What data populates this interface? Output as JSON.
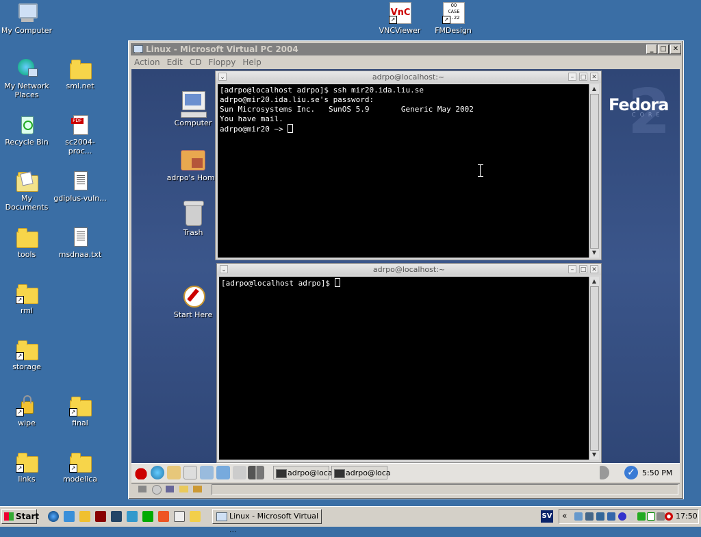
{
  "desktop": {
    "icons": [
      {
        "label": "My Computer",
        "icon": "my-computer-icon"
      },
      {
        "label": "My Network\nPlaces",
        "icon": "network-icon"
      },
      {
        "label": "sml.net",
        "icon": "folder-icon"
      },
      {
        "label": "Recycle Bin",
        "icon": "recycle-bin-icon"
      },
      {
        "label": "sc2004-proc...",
        "icon": "pdf-icon"
      },
      {
        "label": "My Documents",
        "icon": "my-documents-icon"
      },
      {
        "label": "gdiplus-vuln...",
        "icon": "text-file-icon"
      },
      {
        "label": "tools",
        "icon": "folder-icon"
      },
      {
        "label": "msdnaa.txt",
        "icon": "text-file-icon"
      },
      {
        "label": "rml",
        "icon": "folder-shortcut-icon"
      },
      {
        "label": "storage",
        "icon": "folder-shortcut-icon"
      },
      {
        "label": "wipe",
        "icon": "folder-lock-icon"
      },
      {
        "label": "final",
        "icon": "folder-shortcut-icon"
      },
      {
        "label": "links",
        "icon": "folder-shortcut-icon"
      },
      {
        "label": "modelica",
        "icon": "folder-shortcut-icon"
      },
      {
        "label": "VNCViewer",
        "icon": "vnc-icon"
      },
      {
        "label": "FMDesign",
        "icon": "fmdesign-icon"
      }
    ],
    "fmdesign_badge": "OO\nCASE\n3.22",
    "vnc_badge": "VnC"
  },
  "vpc_window": {
    "title": "Linux - Microsoft Virtual PC 2004",
    "menu": [
      "Action",
      "Edit",
      "CD",
      "Floppy",
      "Help"
    ]
  },
  "guest": {
    "icons": [
      {
        "label": "Computer"
      },
      {
        "label": "adrpo's Home"
      },
      {
        "label": "Trash"
      },
      {
        "label": "Start Here"
      }
    ],
    "logo_text": "Fedora",
    "logo_sub": "CORE",
    "terminal1": {
      "title": "adrpo@localhost:~",
      "lines": [
        "[adrpo@localhost adrpo]$ ssh mir20.ida.liu.se",
        "adrpo@mir20.ida.liu.se's password:",
        "Sun Microsystems Inc.   SunOS 5.9       Generic May 2002",
        "You have mail.",
        "adrpo@mir20 ~> "
      ]
    },
    "terminal2": {
      "title": "adrpo@localhost:~",
      "lines": [
        "[adrpo@localhost adrpo]$ "
      ]
    },
    "panel": {
      "tasks": [
        "adrpo@loca",
        "adrpo@loca"
      ],
      "clock": "5:50 PM"
    }
  },
  "taskbar": {
    "start_label": "Start",
    "task_label": "Linux - Microsoft Virtual ...",
    "language": "SV",
    "clock": "17:50",
    "tray_expand": "«"
  },
  "colors": {
    "desktop": "#3a6ea5",
    "terminal_bg": "#000000",
    "title_inactive": "#808080"
  }
}
